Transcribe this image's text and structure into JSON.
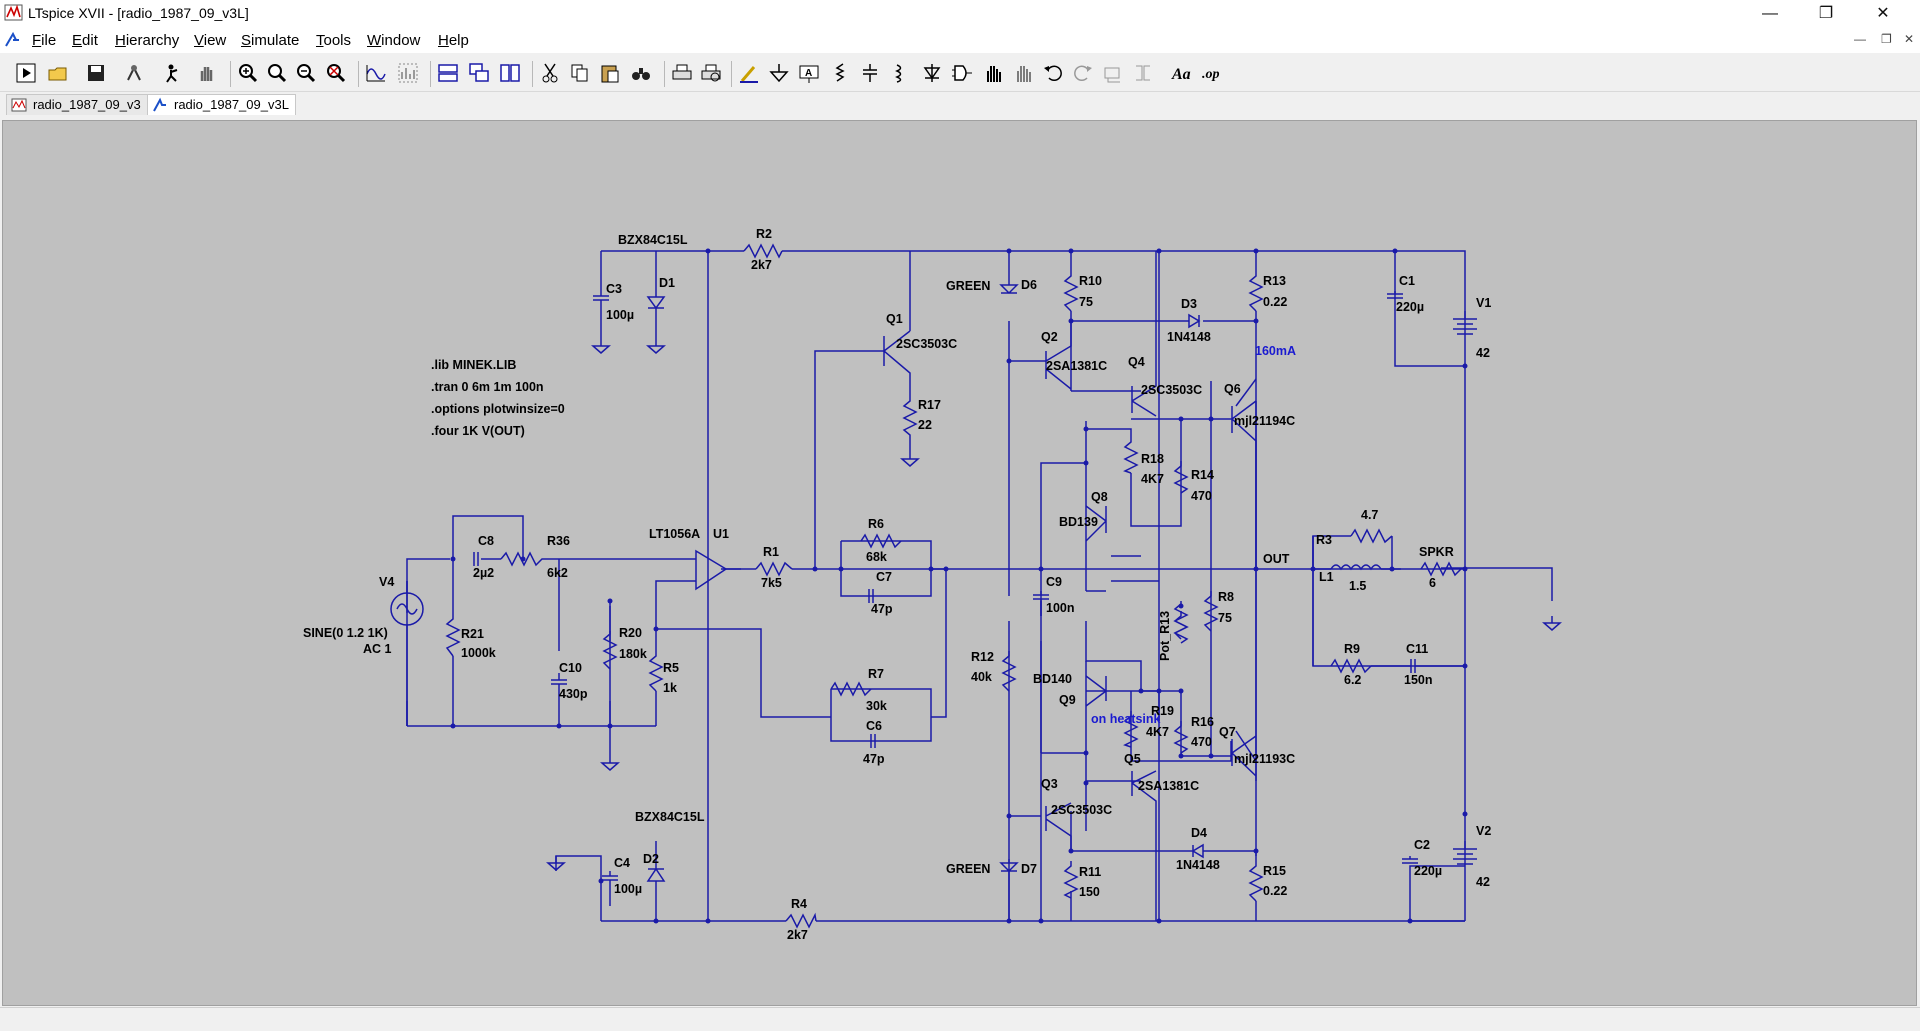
{
  "window": {
    "title": "LTspice XVII - [radio_1987_09_v3L]"
  },
  "menu": [
    {
      "label": "File",
      "u": "F",
      "rest": "ile"
    },
    {
      "label": "Edit",
      "u": "E",
      "rest": "dit"
    },
    {
      "label": "Hierarchy",
      "u": "H",
      "rest": "ierarchy"
    },
    {
      "label": "View",
      "u": "V",
      "rest": "iew"
    },
    {
      "label": "Simulate",
      "u": "S",
      "rest": "imulate"
    },
    {
      "label": "Tools",
      "u": "T",
      "rest": "ools"
    },
    {
      "label": "Window",
      "u": "W",
      "rest": "indow"
    },
    {
      "label": "Help",
      "u": "H",
      "rest": "elp"
    }
  ],
  "tabs": [
    {
      "label": "radio_1987_09_v3",
      "icon": "waveform-icon",
      "active": false
    },
    {
      "label": "radio_1987_09_v3L",
      "icon": "schematic-icon",
      "active": true
    }
  ],
  "toolbar_icons": [
    "run-icon",
    "open-icon",
    "save-icon",
    "control-panel-icon",
    "halt-icon",
    "pan-icon",
    "zoom-in-icon",
    "zoom-out-small-icon",
    "zoom-out-icon",
    "zoom-fit-icon",
    "autorange-icon",
    "fft-icon",
    "tile-horizontal-icon",
    "cascade-icon",
    "tile-vertical-icon",
    "cut-icon",
    "copy-icon",
    "paste-icon",
    "find-icon",
    "print-icon",
    "print-preview-icon",
    "wire-icon",
    "ground-icon",
    "label-icon",
    "resistor-icon",
    "capacitor-icon",
    "inductor-icon",
    "diode-icon",
    "component-icon",
    "move-icon",
    "drag-icon",
    "undo-icon",
    "redo-icon",
    "rotate-icon",
    "mirror-icon",
    "text-icon",
    "spice-directive-icon"
  ],
  "schematic": {
    "colors": {
      "background": "#c0c0c0",
      "wire": "#1a1aa8",
      "text": "#000000",
      "note": "#1a1ad0"
    },
    "directives": [
      ".lib MINEK.LIB",
      ".tran 0 6m 1m 100n",
      ".options plotwinsize=0",
      ".four 1K V(OUT)"
    ],
    "notes": [
      "160mA",
      "on heatsink"
    ],
    "nets": [
      "OUT"
    ],
    "components": [
      {
        "ref": "V4",
        "value": "SINE(0 1.2 1K)",
        "extra": "AC 1"
      },
      {
        "ref": "C8",
        "value": "2µ2"
      },
      {
        "ref": "R36",
        "value": "6k2"
      },
      {
        "ref": "R21",
        "value": "1000k"
      },
      {
        "ref": "C10",
        "value": "430p"
      },
      {
        "ref": "R20",
        "value": "180k"
      },
      {
        "ref": "R5",
        "value": "1k"
      },
      {
        "ref": "U1",
        "value": "LT1056A"
      },
      {
        "ref": "R1",
        "value": "7k5"
      },
      {
        "ref": "R6",
        "value": "68k"
      },
      {
        "ref": "C7",
        "value": "47p"
      },
      {
        "ref": "R7",
        "value": "30k"
      },
      {
        "ref": "C6",
        "value": "47p"
      },
      {
        "ref": "R2",
        "value": "2k7"
      },
      {
        "ref": "R4",
        "value": "2k7"
      },
      {
        "ref": "D1",
        "value": "BZX84C15L"
      },
      {
        "ref": "C3",
        "value": "100µ"
      },
      {
        "ref": "D2",
        "value": "BZX84C15L"
      },
      {
        "ref": "C4",
        "value": "100µ"
      },
      {
        "ref": "Q1",
        "value": "2SC3503C"
      },
      {
        "ref": "R17",
        "value": "22"
      },
      {
        "ref": "D6",
        "value": "GREEN"
      },
      {
        "ref": "D7",
        "value": "GREEN"
      },
      {
        "ref": "R10",
        "value": "75"
      },
      {
        "ref": "Q2",
        "value": "2SA1381C"
      },
      {
        "ref": "Q4",
        "value": "2SC3503C"
      },
      {
        "ref": "D3",
        "value": "1N4148"
      },
      {
        "ref": "R13",
        "value": "0.22"
      },
      {
        "ref": "Q6",
        "value": "mjl21194C"
      },
      {
        "ref": "R18",
        "value": "4K7"
      },
      {
        "ref": "R14",
        "value": "470"
      },
      {
        "ref": "Q8",
        "value": "BD139"
      },
      {
        "ref": "C9",
        "value": "100n"
      },
      {
        "ref": "R12",
        "value": "40k"
      },
      {
        "ref": "R8",
        "value": "75"
      },
      {
        "ref": "Pot_R13",
        "value": ""
      },
      {
        "ref": "R19",
        "value": "4K7"
      },
      {
        "ref": "R16",
        "value": "470"
      },
      {
        "ref": "Q9",
        "value": "BD140"
      },
      {
        "ref": "Q7",
        "value": "mjl21193C"
      },
      {
        "ref": "Q5",
        "value": "2SA1381C"
      },
      {
        "ref": "Q3",
        "value": "2SC3503C"
      },
      {
        "ref": "D4",
        "value": "1N4148"
      },
      {
        "ref": "R11",
        "value": "150"
      },
      {
        "ref": "R15",
        "value": "0.22"
      },
      {
        "ref": "R3",
        "value": "4.7"
      },
      {
        "ref": "L1",
        "value": "1.5"
      },
      {
        "ref": "SPKR",
        "value": "6"
      },
      {
        "ref": "R9",
        "value": "6.2"
      },
      {
        "ref": "C11",
        "value": "150n"
      },
      {
        "ref": "C1",
        "value": "220µ"
      },
      {
        "ref": "V1",
        "value": "42"
      },
      {
        "ref": "C2",
        "value": "220µ"
      },
      {
        "ref": "V2",
        "value": "42"
      }
    ]
  }
}
